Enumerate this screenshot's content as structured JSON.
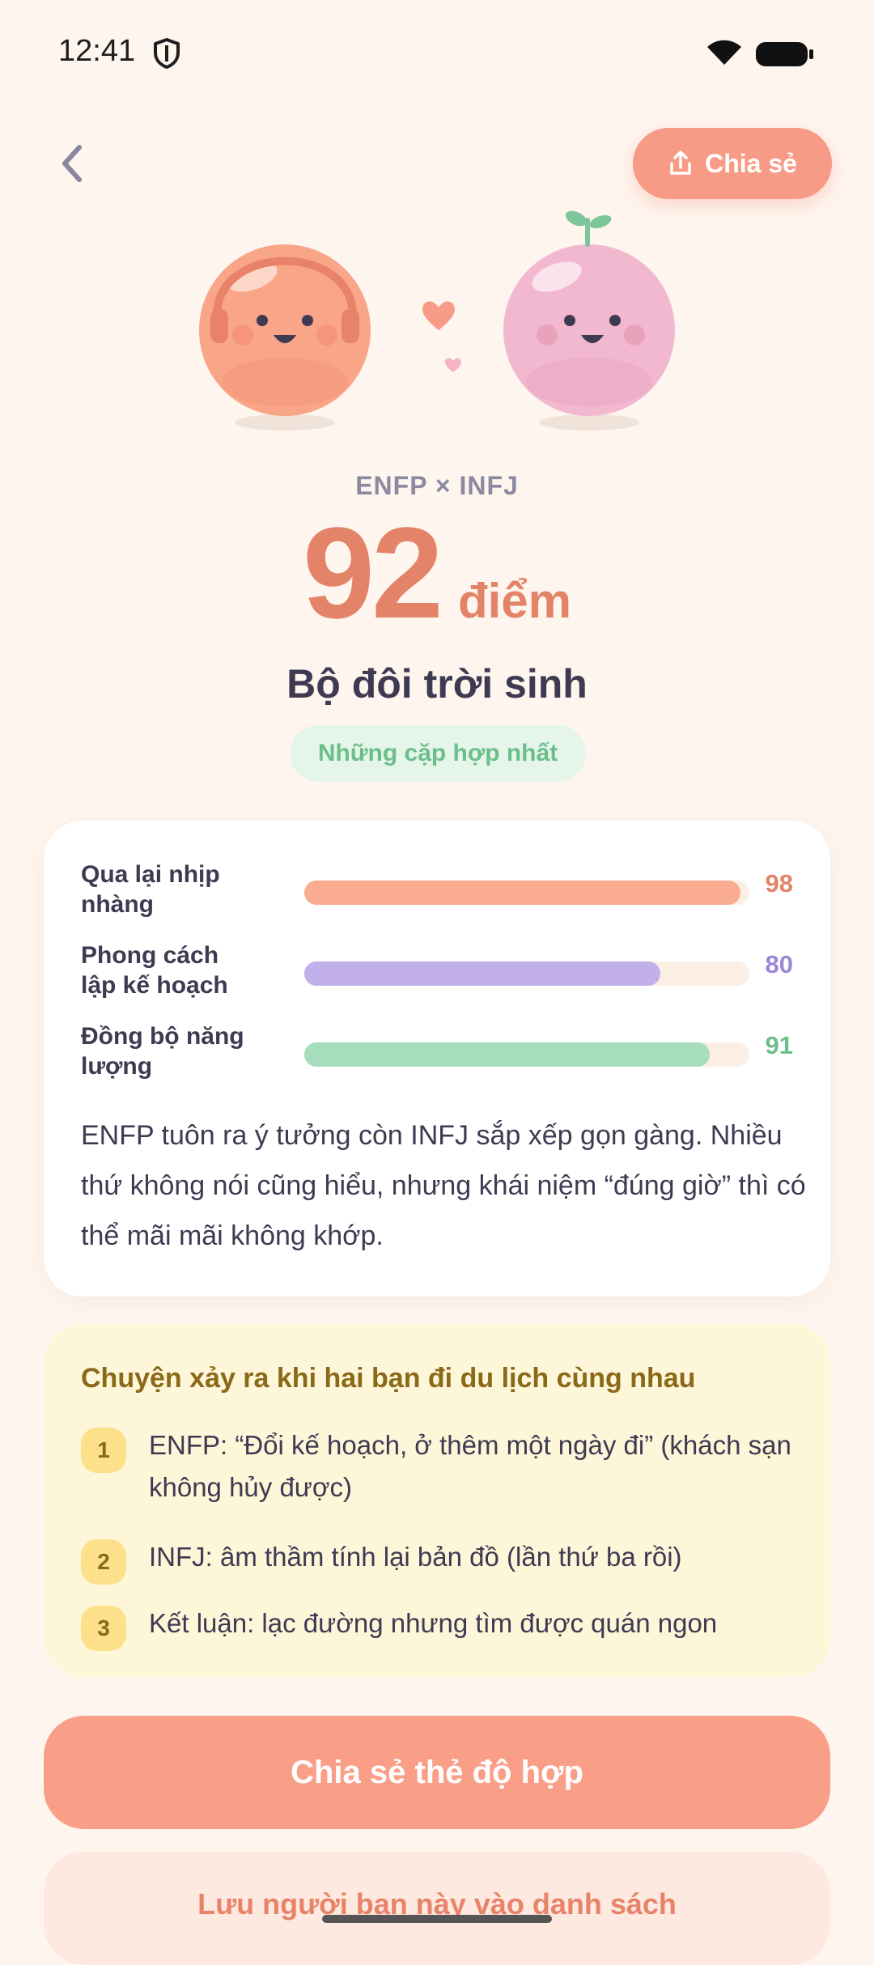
{
  "status_bar": {
    "time": "12:41"
  },
  "header": {
    "share_label": "Chia sẻ"
  },
  "result": {
    "pair": "ENFP × INFJ",
    "score": "92",
    "score_unit": "điểm",
    "title": "Bộ đôi trời sinh",
    "badge": "Những cặp hợp nhất"
  },
  "metrics": [
    {
      "label": "Qua lại nhịp nhàng",
      "value": "98",
      "fraction": 0.98,
      "color": "#f9ac90"
    },
    {
      "label": "Phong cách lập kế hoạch",
      "value": "80",
      "fraction": 0.8,
      "color": "#c2b0ea"
    },
    {
      "label": "Đồng bộ năng lượng",
      "value": "91",
      "fraction": 0.91,
      "color": "#a6ddbd"
    }
  ],
  "metric_value_colors": [
    "#e38368",
    "#9b86d8",
    "#6bbf8a"
  ],
  "description": "ENFP tuôn ra ý tưởng còn INFJ sắp xếp gọn gàng. Nhiều thứ không nói cũng hiểu, nhưng khái niệm “đúng giờ” thì có thể mãi mãi không khớp.",
  "story": {
    "title": "Chuyện xảy ra khi hai bạn đi du lịch cùng nhau",
    "items": [
      {
        "num": "1",
        "text": "ENFP: “Đổi kế hoạch, ở thêm một ngày đi” (khách sạn không hủy được)"
      },
      {
        "num": "2",
        "text": "INFJ: âm thầm tính lại bản đồ (lần thứ ba rồi)"
      },
      {
        "num": "3",
        "text": "Kết luận: lạc đường nhưng tìm được quán ngon"
      }
    ]
  },
  "actions": {
    "primary": "Chia sẻ thẻ độ hợp",
    "secondary": "Lưu người bạn này vào danh sách"
  },
  "icons": [
    "shield-icon",
    "wifi-icon",
    "battery-icon",
    "back-icon",
    "share-icon",
    "heart-icon",
    "headphones-icon",
    "sprout-icon"
  ]
}
